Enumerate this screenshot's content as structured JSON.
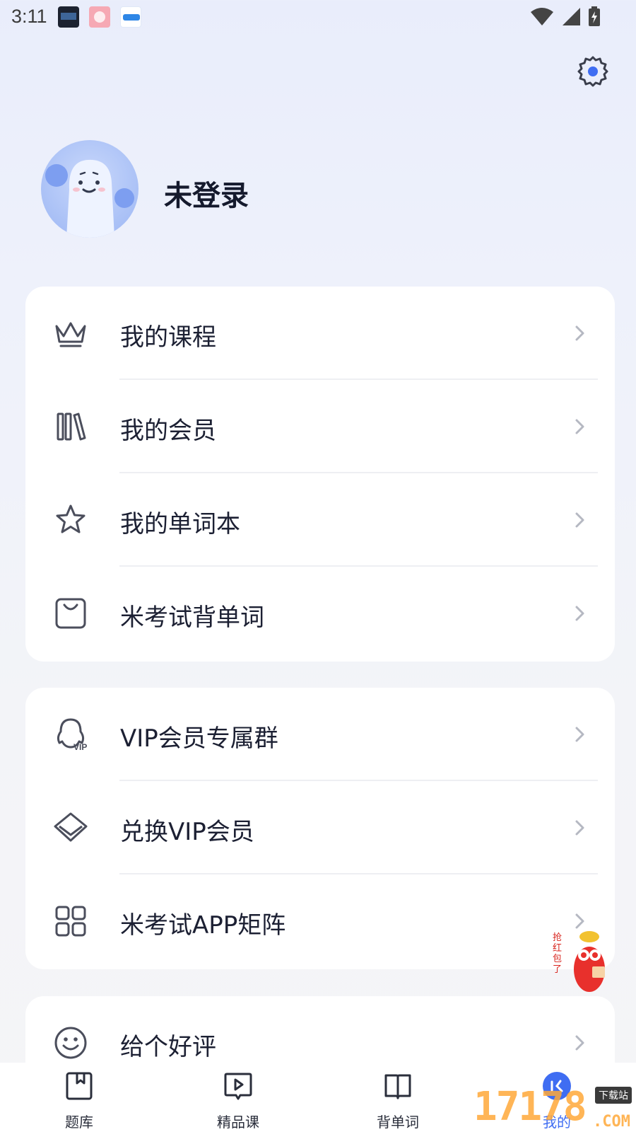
{
  "status_bar": {
    "time": "3:11"
  },
  "profile": {
    "username": "未登录"
  },
  "menu_group_1": [
    {
      "label": "我的课程",
      "icon": "crown-icon"
    },
    {
      "label": "我的会员",
      "icon": "books-icon"
    },
    {
      "label": "我的单词本",
      "icon": "star-icon"
    },
    {
      "label": "米考试背单词",
      "icon": "bag-icon"
    }
  ],
  "menu_group_2": [
    {
      "label": "VIP会员专属群",
      "icon": "vip-group-icon"
    },
    {
      "label": "兑换VIP会员",
      "icon": "diamond-icon"
    },
    {
      "label": "米考试APP矩阵",
      "icon": "grid-icon"
    }
  ],
  "menu_group_3": [
    {
      "label": "给个好评",
      "icon": "smiley-icon"
    }
  ],
  "red_packet": {
    "text": "抢红包了"
  },
  "bottom_nav": [
    {
      "label": "题库",
      "icon": "bookmark-book-icon",
      "active": false
    },
    {
      "label": "精品课",
      "icon": "play-icon",
      "active": false
    },
    {
      "label": "背单词",
      "icon": "open-book-icon",
      "active": false
    },
    {
      "label": "我的",
      "icon": "profile-icon",
      "active": true
    }
  ],
  "watermark": {
    "digits": "17178",
    "tag": "下载站",
    "suffix": ".COM"
  },
  "colors": {
    "accent": "#3f6df2",
    "text": "#1c2033",
    "chevron": "#b5b8c2",
    "icon": "#4b4e5c"
  }
}
